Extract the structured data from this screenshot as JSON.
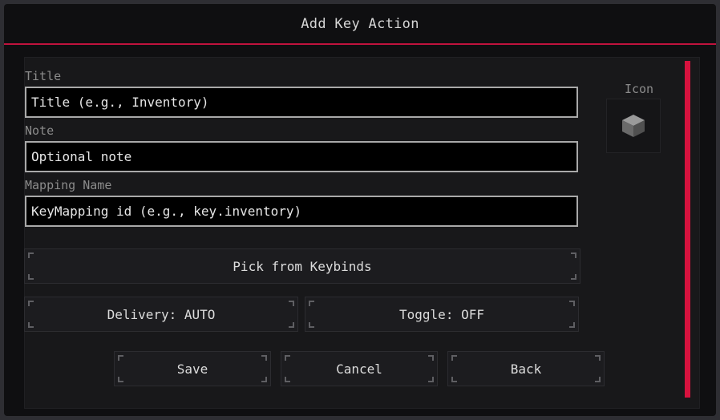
{
  "dialog": {
    "title": "Add Key Action"
  },
  "fields": {
    "title": {
      "label": "Title",
      "placeholder": "Title (e.g., Inventory)",
      "value": ""
    },
    "note": {
      "label": "Note",
      "placeholder": "Optional note",
      "value": ""
    },
    "mapping": {
      "label": "Mapping Name",
      "placeholder": "KeyMapping id (e.g., key.inventory)",
      "value": ""
    }
  },
  "icon": {
    "label": "Icon",
    "current": "stone-block-icon"
  },
  "buttons": {
    "pick_from_keybinds": "Pick from Keybinds",
    "delivery": "Delivery: AUTO",
    "toggle": "Toggle: OFF",
    "save": "Save",
    "cancel": "Cancel",
    "back": "Back"
  },
  "colors": {
    "accent": "#c0133d",
    "scrollbar": "#d6123e",
    "background": "#0f0f11",
    "input_border": "#a9a9a9"
  }
}
